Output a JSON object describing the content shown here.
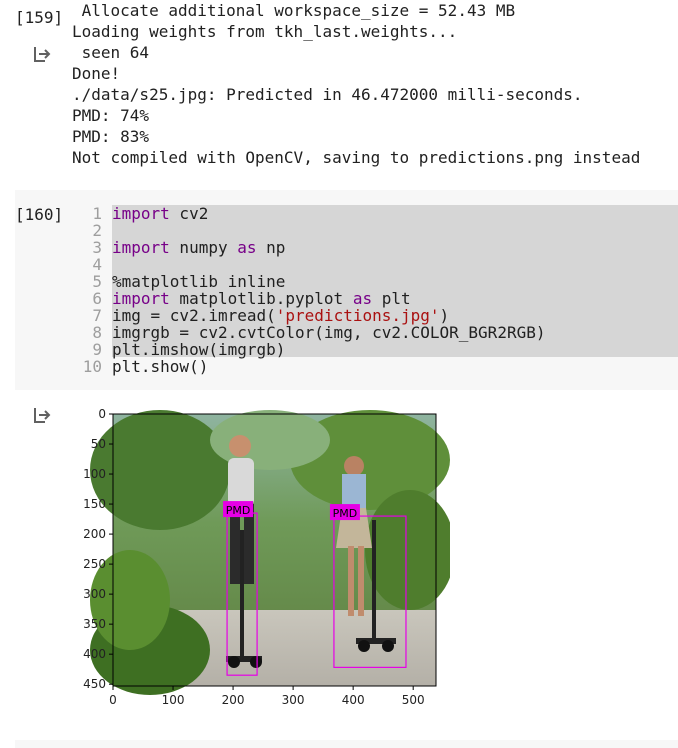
{
  "cell159": {
    "exec_count": "[159]",
    "output_lines": [
      " Allocate additional workspace_size = 52.43 MB",
      "Loading weights from tkh_last.weights...",
      " seen 64",
      "Done!",
      "./data/s25.jpg: Predicted in 46.472000 milli-seconds.",
      "PMD: 74%",
      "PMD: 83%",
      "Not compiled with OpenCV, saving to predictions.png instead"
    ]
  },
  "cell160": {
    "exec_count": "[160]",
    "line_numbers": [
      "1",
      "2",
      "3",
      "4",
      "5",
      "6",
      "7",
      "8",
      "9",
      "10"
    ],
    "code": {
      "l1_kw": "import",
      "l1_rest": " cv2",
      "l3_kw": "import",
      "l3_mid": " numpy ",
      "l3_as": "as",
      "l3_rest": " np",
      "l5": "%matplotlib inline",
      "l6_kw": "import",
      "l6_mid": " matplotlib.pyplot ",
      "l6_as": "as",
      "l6_rest": " plt",
      "l7_a": "img = cv2.imread(",
      "l7_str": "'predictions.jpg'",
      "l7_b": ")",
      "l8": "imgrgb = cv2.cvtColor(img, cv2.COLOR_BGR2RGB)",
      "l9": "plt.imshow(imgrgb)",
      "l10": "plt.show()"
    }
  },
  "plot": {
    "x_ticks": [
      "0",
      "100",
      "200",
      "300",
      "400",
      "500"
    ],
    "y_ticks": [
      "0",
      "50",
      "100",
      "150",
      "200",
      "250",
      "300",
      "350",
      "400",
      "450"
    ],
    "detection_label": "PMD",
    "box_color": "#e600e6",
    "detections": [
      {
        "label": "PMD",
        "x1": 190,
        "y1": 165,
        "x2": 240,
        "y2": 435
      },
      {
        "label": "PMD",
        "x1": 368,
        "y1": 170,
        "x2": 488,
        "y2": 422
      }
    ]
  },
  "icons": {
    "output": "output-arrow-icon"
  }
}
